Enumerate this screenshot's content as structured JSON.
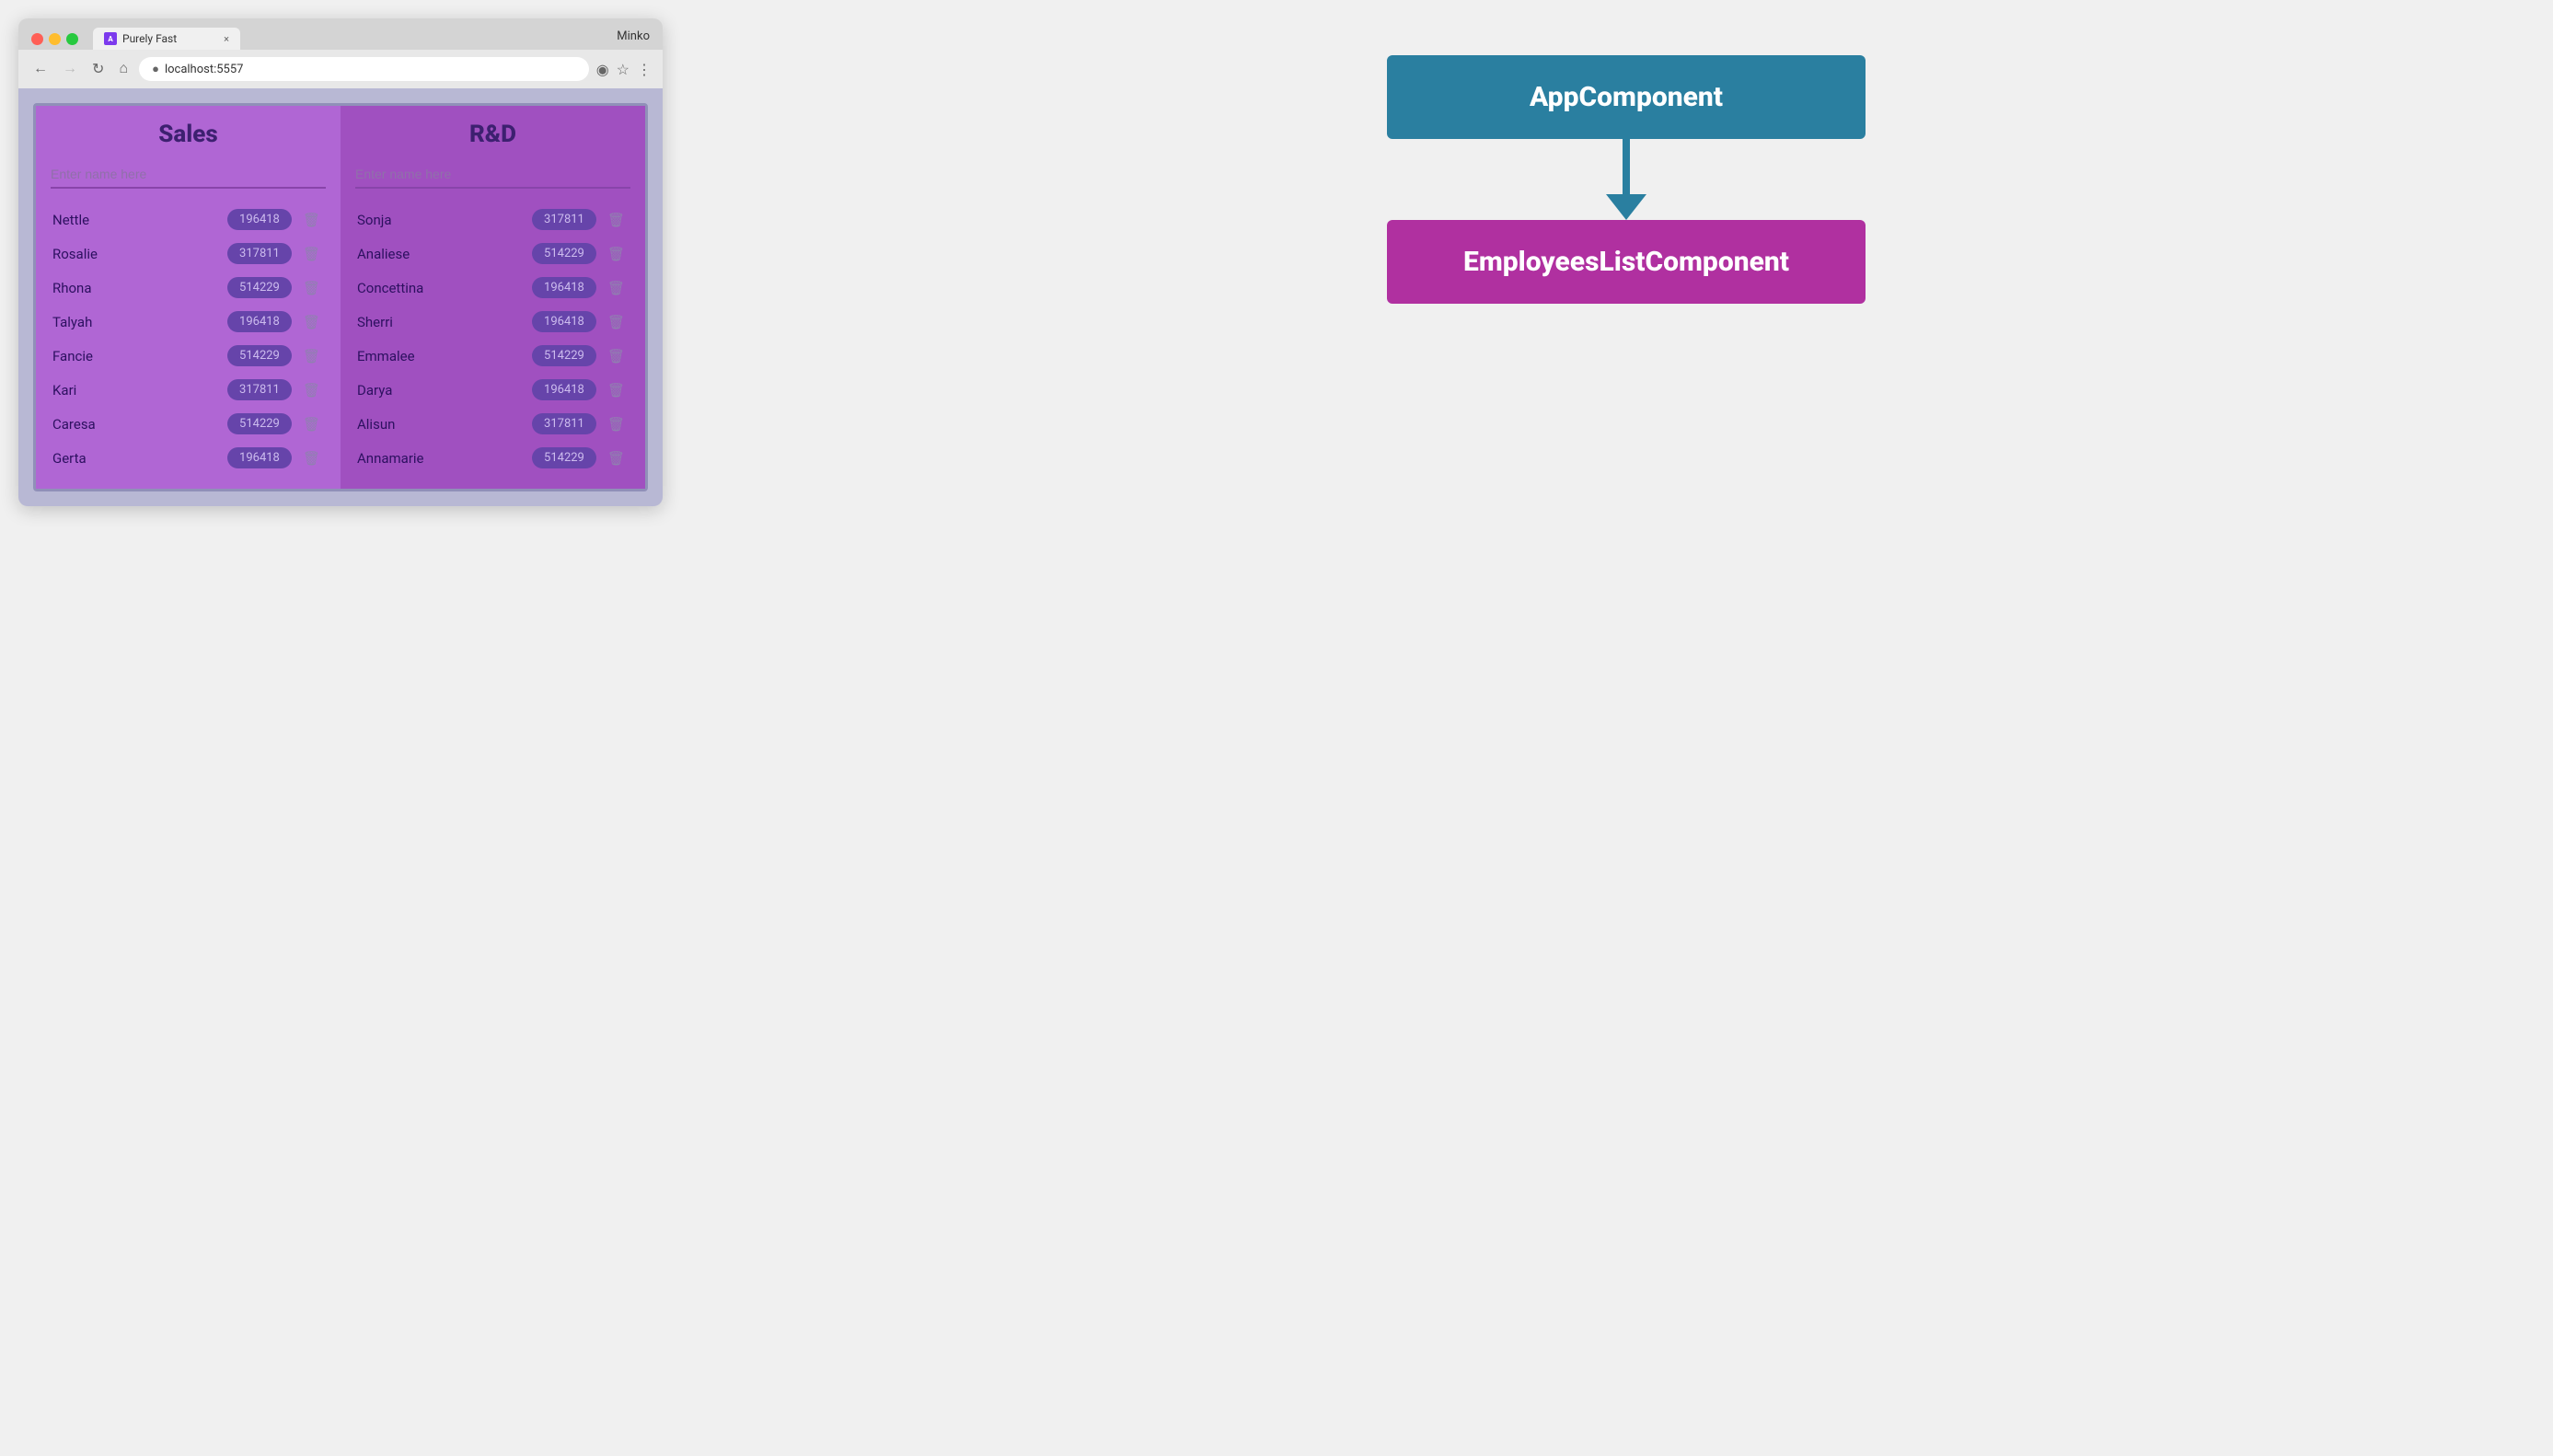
{
  "browser": {
    "tab_title": "Purely Fast",
    "tab_close": "×",
    "user": "Minko",
    "url": "localhost:5557",
    "nav_back": "←",
    "nav_forward": "→",
    "nav_refresh": "↻",
    "nav_home": "⌂"
  },
  "app": {
    "departments": [
      {
        "id": "sales",
        "title": "Sales",
        "input_placeholder": "Enter name here",
        "employees": [
          {
            "name": "Nettle",
            "badge": "196418"
          },
          {
            "name": "Rosalie",
            "badge": "317811"
          },
          {
            "name": "Rhona",
            "badge": "514229"
          },
          {
            "name": "Talyah",
            "badge": "196418"
          },
          {
            "name": "Fancie",
            "badge": "514229"
          },
          {
            "name": "Kari",
            "badge": "317811"
          },
          {
            "name": "Caresa",
            "badge": "514229"
          },
          {
            "name": "Gerta",
            "badge": "196418"
          }
        ]
      },
      {
        "id": "rnd",
        "title": "R&D",
        "input_placeholder": "Enter name here",
        "employees": [
          {
            "name": "Sonja",
            "badge": "317811"
          },
          {
            "name": "Analiese",
            "badge": "514229"
          },
          {
            "name": "Concettina",
            "badge": "196418"
          },
          {
            "name": "Sherri",
            "badge": "196418"
          },
          {
            "name": "Emmalee",
            "badge": "514229"
          },
          {
            "name": "Darya",
            "badge": "196418"
          },
          {
            "name": "Alisun",
            "badge": "317811"
          },
          {
            "name": "Annamarie",
            "badge": "514229"
          }
        ]
      }
    ]
  },
  "diagram": {
    "app_component_label": "AppComponent",
    "employees_component_label": "EmployeesListComponent"
  }
}
